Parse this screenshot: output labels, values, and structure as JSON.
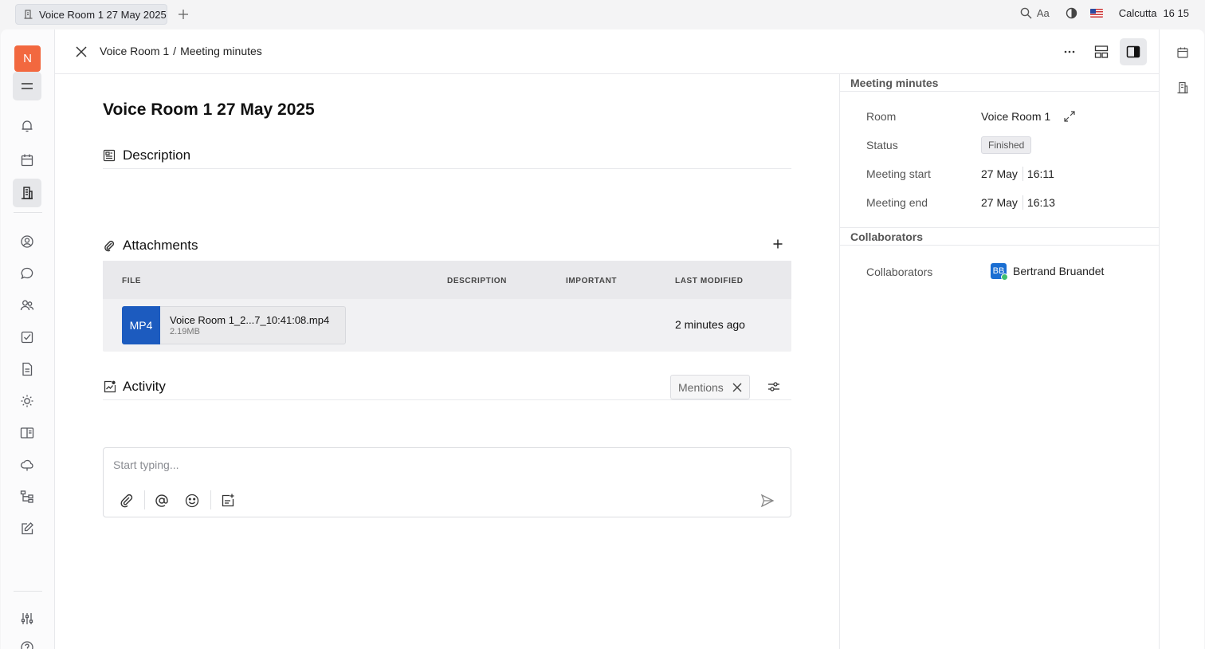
{
  "topbar": {
    "tab_title": "Voice Room 1 27 May 2025",
    "font_label": "Aa",
    "location": "Calcutta",
    "time": "16 15"
  },
  "sidebar": {
    "workspace_initial": "N",
    "items": [
      "menu-icon",
      "bell-icon",
      "calendar-icon",
      "office-icon",
      "contacts-icon",
      "chat-icon",
      "people-icon",
      "tasks-icon",
      "document-icon",
      "sun-icon",
      "book-icon",
      "cloud-icon",
      "tree-icon",
      "edit-icon",
      "settings-sliders-icon",
      "help-icon"
    ]
  },
  "header": {
    "breadcrumb_parent": "Voice Room 1",
    "breadcrumb_sep": "/",
    "breadcrumb_current": "Meeting minutes"
  },
  "document": {
    "title": "Voice Room 1 27 May 2025",
    "description_heading": "Description",
    "attachments_heading": "Attachments",
    "activity_heading": "Activity"
  },
  "attachments": {
    "columns": {
      "file": "FILE",
      "description": "DESCRIPTION",
      "important": "IMPORTANT",
      "last_modified": "LAST MODIFIED"
    },
    "rows": [
      {
        "type": "MP4",
        "name": "Voice Room 1_2...7_10:41:08.mp4",
        "size": "2.19MB",
        "last_modified": "2 minutes ago"
      }
    ]
  },
  "activity": {
    "filter_chip": "Mentions",
    "composer_placeholder": "Start typing..."
  },
  "panel": {
    "meeting_heading": "Meeting minutes",
    "room_label": "Room",
    "room_value": "Voice Room 1",
    "status_label": "Status",
    "status_value": "Finished",
    "start_label": "Meeting start",
    "start_date": "27 May",
    "start_time": "16:11",
    "end_label": "Meeting end",
    "end_date": "27 May",
    "end_time": "16:13",
    "collab_heading": "Collaborators",
    "collab_label": "Collaborators",
    "collab_initials": "BB",
    "collab_name": "Bertrand Bruandet"
  },
  "colors": {
    "accent": "#1c5bbf",
    "workspace": "#f2683f",
    "online": "#3fbf6f"
  }
}
